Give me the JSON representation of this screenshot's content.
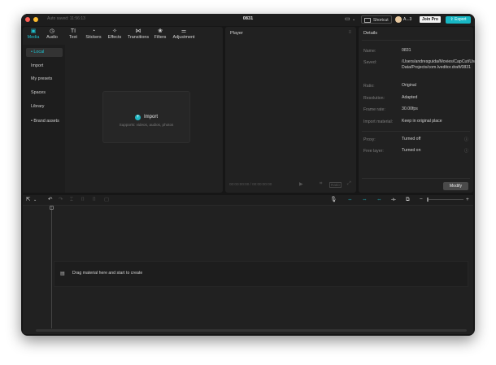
{
  "titlebar": {
    "autosave": "Auto saved: 11:56:13",
    "title": "0831",
    "shortcut_label": "Shortcut",
    "user_name": "A...3",
    "join_pro": "Join Pro",
    "export": "Export"
  },
  "media_tabs": [
    {
      "label": "Media",
      "icon": "media-icon"
    },
    {
      "label": "Audio",
      "icon": "audio-icon"
    },
    {
      "label": "Text",
      "icon": "text-icon"
    },
    {
      "label": "Stickers",
      "icon": "stickers-icon"
    },
    {
      "label": "Effects",
      "icon": "effects-icon"
    },
    {
      "label": "Transitions",
      "icon": "transitions-icon"
    },
    {
      "label": "Filters",
      "icon": "filters-icon"
    },
    {
      "label": "Adjustment",
      "icon": "adjustment-icon"
    }
  ],
  "sidebar": {
    "items": [
      {
        "label": "• Local"
      },
      {
        "label": "Import"
      },
      {
        "label": "My presets"
      },
      {
        "label": "Spaces"
      },
      {
        "label": "Library"
      },
      {
        "label": "• Brand assets"
      }
    ]
  },
  "import_box": {
    "label": "Import",
    "hint": "Supports: videos, audios, photos"
  },
  "player": {
    "title": "Player",
    "timecode": "00:00:00:00 / 00:00:00:00",
    "ratio_button": "Ratio"
  },
  "details": {
    "title": "Details",
    "fields": [
      {
        "label": "Name:",
        "value": "0831"
      },
      {
        "label": "Saved:",
        "value": "/Users/andresguida/Movies/CapCut/User Data/Projects/com.lveditor.draft/0831"
      },
      {
        "label": "Ratio:",
        "value": "Original"
      },
      {
        "label": "Resolution:",
        "value": "Adapted"
      },
      {
        "label": "Frame rate:",
        "value": "30.00fps"
      },
      {
        "label": "Import material:",
        "value": "Keep in original place"
      },
      {
        "label": "Proxy:",
        "value": "Turned off"
      },
      {
        "label": "Free layer:",
        "value": "Turned on"
      }
    ],
    "modify_button": "Modify"
  },
  "timeline": {
    "drop_hint": "Drag material here and start to create"
  },
  "colors": {
    "accent": "#1fb7c4",
    "background": "#161616",
    "panel": "#212121"
  }
}
